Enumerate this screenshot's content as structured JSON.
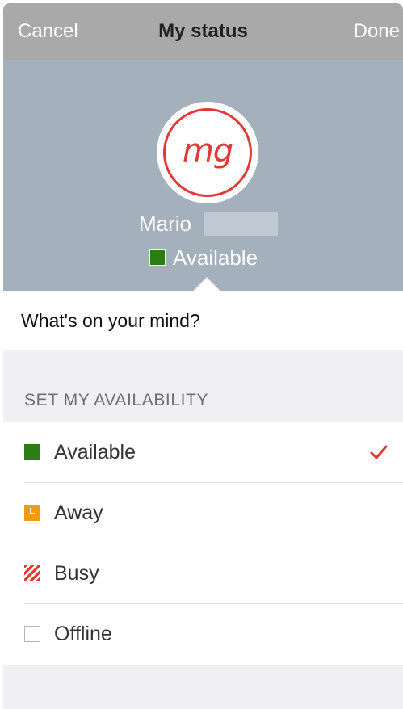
{
  "navbar": {
    "cancel_label": "Cancel",
    "title": "My status",
    "done_label": "Done"
  },
  "profile": {
    "initials": "mg",
    "first_name": "Mario",
    "status_label": "Available",
    "status_color": "#2e7d14",
    "accent_color": "#e03a36"
  },
  "mind": {
    "placeholder": "What's on your mind?"
  },
  "availability": {
    "section_title": "SET MY AVAILABILITY",
    "options": [
      {
        "label": "Available",
        "icon": "available-square-icon",
        "color": "#2e7d14",
        "selected": true
      },
      {
        "label": "Away",
        "icon": "away-clock-icon",
        "color": "#f29b11",
        "selected": false
      },
      {
        "label": "Busy",
        "icon": "busy-striped-icon",
        "color": "#e03a36",
        "selected": false
      },
      {
        "label": "Offline",
        "icon": "offline-square-icon",
        "color": "#b5b5b5",
        "selected": false
      }
    ]
  }
}
